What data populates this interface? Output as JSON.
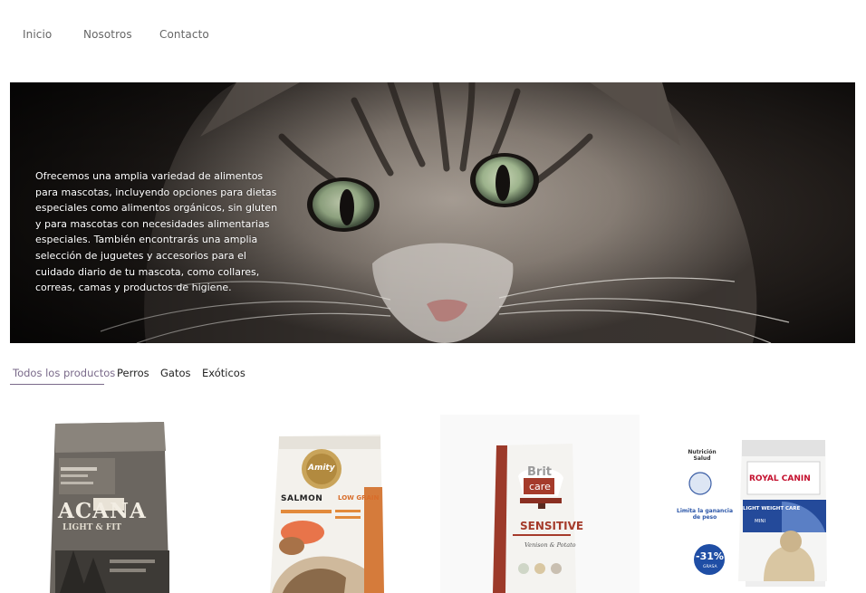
{
  "nav": {
    "items": [
      {
        "label": "Inicio"
      },
      {
        "label": "Nosotros"
      },
      {
        "label": "Contacto"
      }
    ]
  },
  "hero": {
    "text": "Ofrecemos una amplia variedad de alimentos para mascotas, incluyendo opciones para dietas especiales como alimentos orgánicos, sin gluten y para mascotas con necesidades alimentarias especiales. También encontrarás una amplia selección de juguetes y accesorios para el cuidado diario de tu mascota, como collares, correas, camas y productos de higiene."
  },
  "tabs": [
    {
      "label": "Todos los productos",
      "active": true
    },
    {
      "label": "Perros"
    },
    {
      "label": "Gatos"
    },
    {
      "label": "Exóticos"
    }
  ],
  "products": [
    {
      "brand": "ACANA",
      "line": "LIGHT & FIT"
    },
    {
      "brand": "Amity",
      "line1": "SALMON",
      "line2": "LOW GRAIN"
    },
    {
      "brand_top": "Brit",
      "brand_bottom": "care",
      "line": "SENSITIVE",
      "sub": "Venison & Potato"
    },
    {
      "brand": "ROYAL CANIN",
      "line": "LIGHT WEIGHT CARE",
      "sub": "MINI",
      "side_top": "Nutrición Salud",
      "side_mid": "Limita la ganancia de peso",
      "badge": "-31%",
      "badge_sub": "GRASA"
    }
  ],
  "colors": {
    "accent": "#7a6a8a",
    "nav_text": "#666666"
  }
}
